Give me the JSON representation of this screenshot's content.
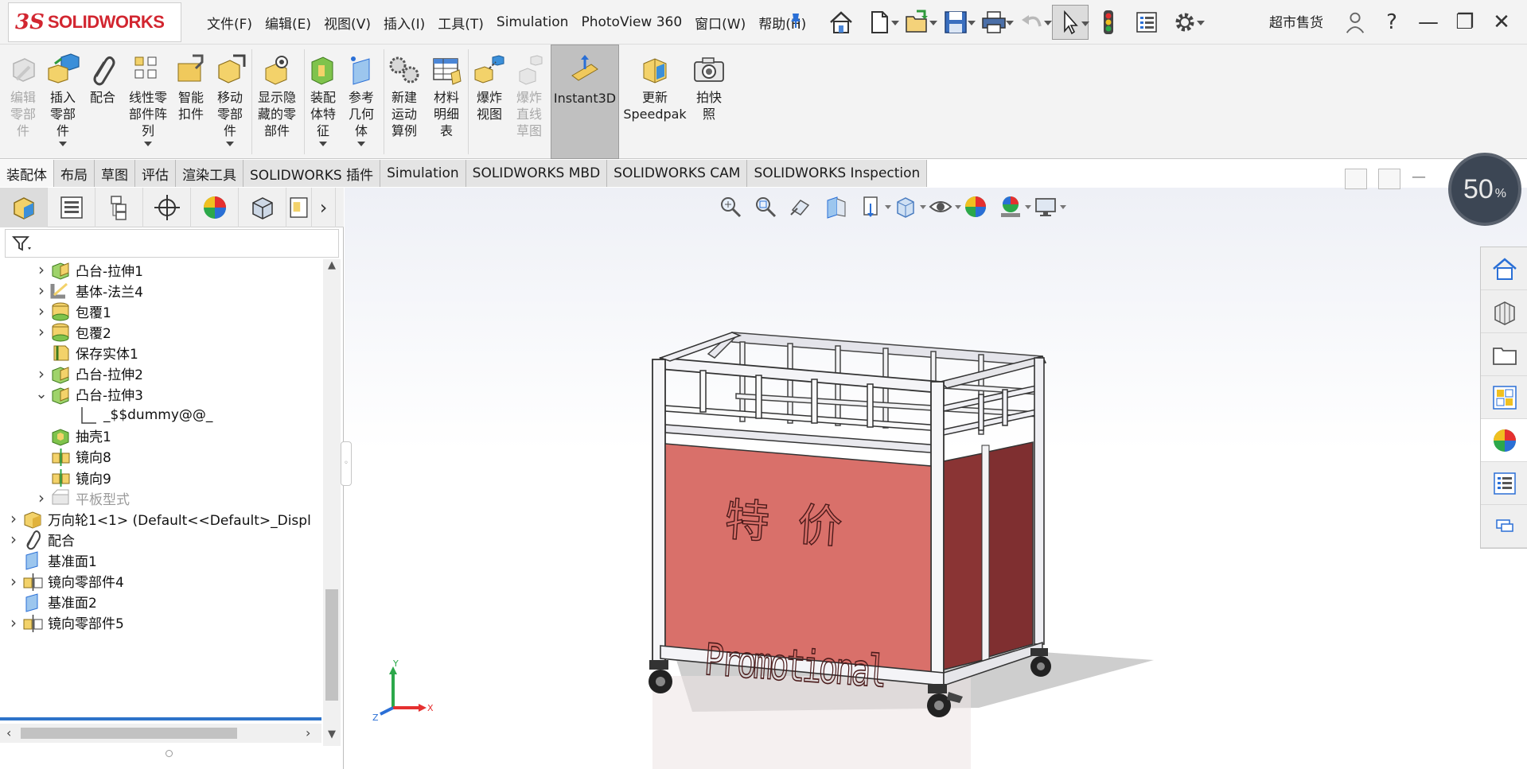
{
  "app": {
    "logo_ds": "3S",
    "logo_name": "SOLIDWORKS",
    "user": "超市售货"
  },
  "menu": [
    "文件(F)",
    "编辑(E)",
    "视图(V)",
    "插入(I)",
    "工具(T)",
    "Simulation",
    "PhotoView 360",
    "窗口(W)",
    "帮助(H)"
  ],
  "ribbon": {
    "edit_component": "编辑\n零部\n件",
    "insert_component": "插入\n零部\n件",
    "mate": "配合",
    "linear_pattern": "线性零\n部件阵\n列",
    "smart_fasteners": "智能\n扣件",
    "move_component": "移动\n零部\n件",
    "show_hidden": "显示隐\n藏的零\n部件",
    "assembly_features": "装配\n体特\n征",
    "reference_geometry": "参考\n几何\n体",
    "new_motion_study": "新建\n运动\n算例",
    "bill_of_materials": "材料\n明细\n表",
    "exploded_view": "爆炸\n视图",
    "explode_line_sketch": "爆炸\n直线\n草图",
    "instant3d": "Instant3D",
    "update_speedpak": "更新\nSpeedpak",
    "snapshot": "拍快\n照"
  },
  "tabs": [
    "装配体",
    "布局",
    "草图",
    "评估",
    "渲染工具",
    "SOLIDWORKS 插件",
    "Simulation",
    "SOLIDWORKS MBD",
    "SOLIDWORKS CAM",
    "SOLIDWORKS Inspection"
  ],
  "tree": [
    {
      "label": "凸台-拉伸1",
      "icon": "boss-extrude-icon",
      "indent": 1,
      "arrow": "▶"
    },
    {
      "label": "基体-法兰4",
      "icon": "base-flange-icon",
      "indent": 1,
      "arrow": "▶"
    },
    {
      "label": "包覆1",
      "icon": "wrap-icon",
      "indent": 1,
      "arrow": "▶"
    },
    {
      "label": "包覆2",
      "icon": "wrap-icon",
      "indent": 1,
      "arrow": "▶"
    },
    {
      "label": "保存实体1",
      "icon": "save-bodies-icon",
      "indent": 1,
      "arrow": ""
    },
    {
      "label": "凸台-拉伸2",
      "icon": "boss-extrude-icon",
      "indent": 1,
      "arrow": "▶"
    },
    {
      "label": "凸台-拉伸3",
      "icon": "boss-extrude-icon",
      "indent": 1,
      "arrow": "▼"
    },
    {
      "label": "_$$dummy@@_",
      "icon": "sketch-icon",
      "indent": 2,
      "arrow": ""
    },
    {
      "label": "抽壳1",
      "icon": "shell-icon",
      "indent": 1,
      "arrow": ""
    },
    {
      "label": "镜向8",
      "icon": "mirror-icon",
      "indent": 1,
      "arrow": ""
    },
    {
      "label": "镜向9",
      "icon": "mirror-icon",
      "indent": 1,
      "arrow": ""
    },
    {
      "label": "平板型式",
      "icon": "flat-pattern-icon",
      "indent": 1,
      "arrow": "▶",
      "dim": true
    },
    {
      "label": "万向轮1<1> (Default<<Default>_Displ",
      "icon": "part-icon",
      "indent": 0,
      "arrow": "▶"
    },
    {
      "label": "配合",
      "icon": "mates-icon",
      "indent": 0,
      "arrow": "▶"
    },
    {
      "label": "基准面1",
      "icon": "plane-icon",
      "indent": 0,
      "arrow": ""
    },
    {
      "label": "镜向零部件4",
      "icon": "mirror-component-icon",
      "indent": 0,
      "arrow": "▶"
    },
    {
      "label": "基准面2",
      "icon": "plane-icon",
      "indent": 0,
      "arrow": ""
    },
    {
      "label": "镜向零部件5",
      "icon": "mirror-component-icon",
      "indent": 0,
      "arrow": "▶"
    }
  ],
  "viewport": {
    "zoom_value": "50",
    "zoom_unit": "%",
    "triad_x": "X",
    "triad_y": "Y",
    "triad_z": "Z",
    "panel_text_cn": "特  价",
    "panel_text_en": "Promotional"
  },
  "colors": {
    "accent": "#2d73c9",
    "brand": "#d22630",
    "panel_front": "#d9706a",
    "panel_side": "#8a3434"
  }
}
